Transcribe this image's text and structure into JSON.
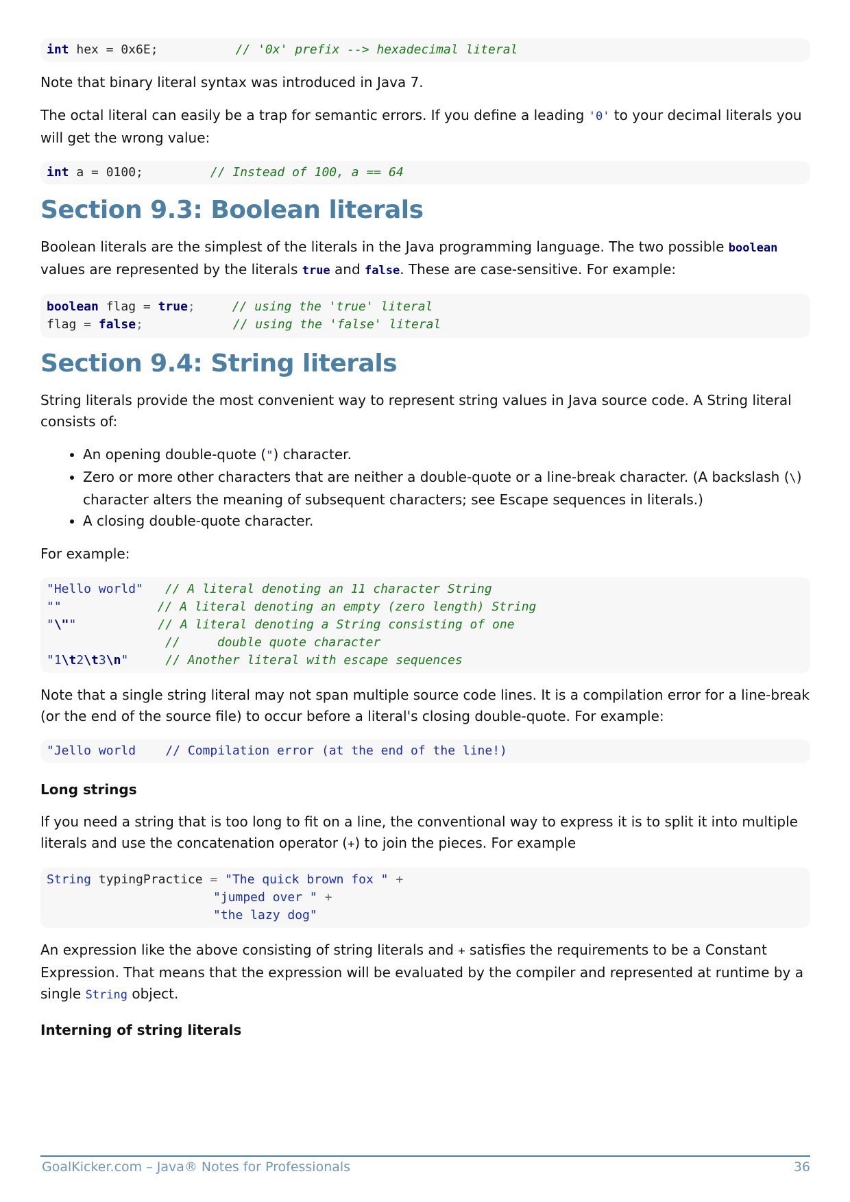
{
  "code1": {
    "kw": "int",
    "rest": " hex = 0x6E;",
    "comment": "// '0x' prefix --> hexadecimal literal"
  },
  "p_binary": "Note that binary literal syntax was introduced in Java 7.",
  "p_octal": {
    "before": "The octal literal can easily be a trap for semantic errors. If you define a leading ",
    "code": "'0'",
    "after": " to your decimal literals you will get the wrong value:"
  },
  "code2": {
    "kw": "int",
    "rest": " a = 0100;",
    "comment": "// Instead of 100, a == 64"
  },
  "section93": "Section 9.3: Boolean literals",
  "p_boolean": {
    "t1": "Boolean literals are the simplest of the literals in the Java programming language. The two possible ",
    "c1": "boolean",
    "t2": " values are represented by the literals ",
    "c2": "true",
    "t3": " and ",
    "c3": "false",
    "t4": ". These are case-sensitive. For example:"
  },
  "code3": {
    "l1_kw": "boolean",
    "l1_mid": " flag = ",
    "l1_val": "true",
    "l1_end": ";",
    "l1_comment": "// using the 'true' literal",
    "l2_start": "flag = ",
    "l2_val": "false",
    "l2_end": ";",
    "l2_comment": "// using the 'false' literal"
  },
  "section94": "Section 9.4: String literals",
  "p_string": "String literals provide the most convenient way to represent string values in Java source code. A String literal consists of:",
  "bullets": {
    "b1_before": "An opening double-quote (",
    "b1_code": "\"",
    "b1_after": ") character.",
    "b2_before": "Zero or more other characters that are neither a double-quote or a line-break character. (A backslash (",
    "b2_code": "\\",
    "b2_after": ") character alters the meaning of subsequent characters; see Escape sequences in literals.)",
    "b3": "A closing double-quote character."
  },
  "p_forexample": "For example:",
  "code4": {
    "r1_lit": "\"Hello world\"",
    "r1_comment": "// A literal denoting an 11 character String",
    "r2_lit": "\"\"",
    "r2_comment": "// A literal denoting an empty (zero length) String",
    "r3_lit_a": "\"",
    "r3_lit_b": "\\\"",
    "r3_lit_c": "\"",
    "r3_comment": "// A literal denoting a String consisting of one",
    "r4_comment": "//     double quote character",
    "r5_a": "\"1",
    "r5_b": "\\t",
    "r5_c": "2",
    "r5_d": "\\t",
    "r5_e": "3",
    "r5_f": "\\n",
    "r5_g": "\"",
    "r5_comment": "// Another literal with escape sequences"
  },
  "p_span": "Note that a single string literal may not span multiple source code lines. It is a compilation error for a line-break (or the end of the source file) to occur before a literal's closing double-quote. For example:",
  "code5": "\"Jello world    // Compilation error (at the end of the line!)",
  "h_long": "Long strings",
  "p_long": {
    "before": "If you need a string that is too long to fit on a line, the conventional way to express it is to split it into multiple literals and use the concatenation operator (",
    "code": "+",
    "after": ") to join the pieces. For example"
  },
  "code6": {
    "type": "String",
    "var": " typingPractice ",
    "eq": "=",
    "s1": "\"The quick brown fox \"",
    "s2": "\"jumped over \"",
    "s3": "\"the lazy dog\"",
    "plus": "+"
  },
  "p_constant": {
    "before": "An expression like the above consisting of string literals and ",
    "code1": "+",
    "mid": " satisfies the requirements to be a Constant Expression. That means that the expression will be evaluated by the compiler and represented at runtime by a single ",
    "code2": "String",
    "after": " object."
  },
  "h_intern": "Interning of string literals",
  "footer": {
    "left": "GoalKicker.com – Java® Notes for Professionals",
    "page": "36"
  }
}
